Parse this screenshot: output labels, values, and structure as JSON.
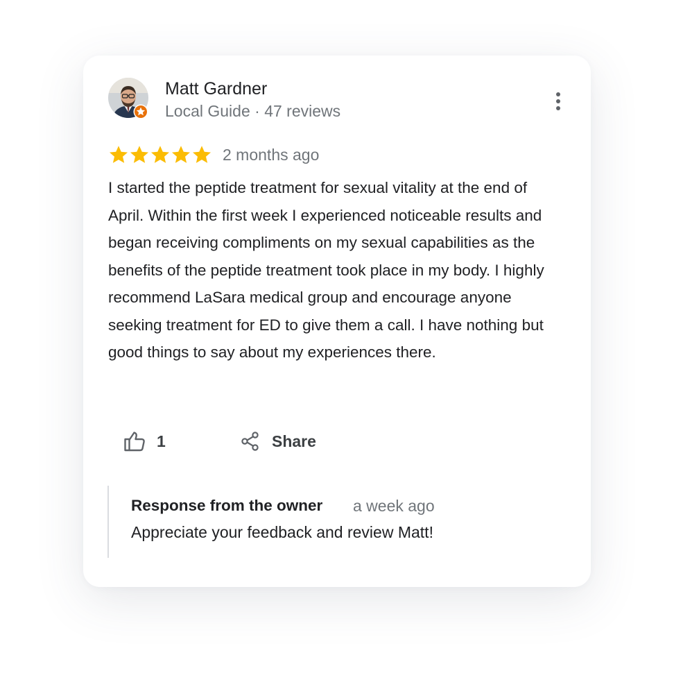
{
  "review": {
    "reviewer_name": "Matt Gardner",
    "reviewer_meta": "Local Guide · 47 reviews",
    "avatar_icon": "person-avatar",
    "badge_icon": "local-guide-star-badge",
    "more_icon": "more-vert-icon",
    "rating": 5,
    "rating_max": 5,
    "date": "2 months ago",
    "text": "I started the peptide treatment for sexual vitality at the end of April. Within  the first week I experienced noticeable results and began receiving compliments on my sexual capabilities as the benefits of the peptide treatment took place in my body. I highly recommend LaSara medical group and encourage anyone seeking treatment for ED to give them a call. I have nothing but good things to say about my experiences there.",
    "like_count": "1",
    "share_label": "Share"
  },
  "owner_response": {
    "title": "Response from the owner",
    "date": "a week ago",
    "text": "Appreciate your feedback and review Matt!"
  },
  "colors": {
    "star": "#FBBC04",
    "badge": "#E8710A",
    "text_primary": "#202124",
    "text_secondary": "#70757A",
    "action_icon": "#5F6368"
  }
}
